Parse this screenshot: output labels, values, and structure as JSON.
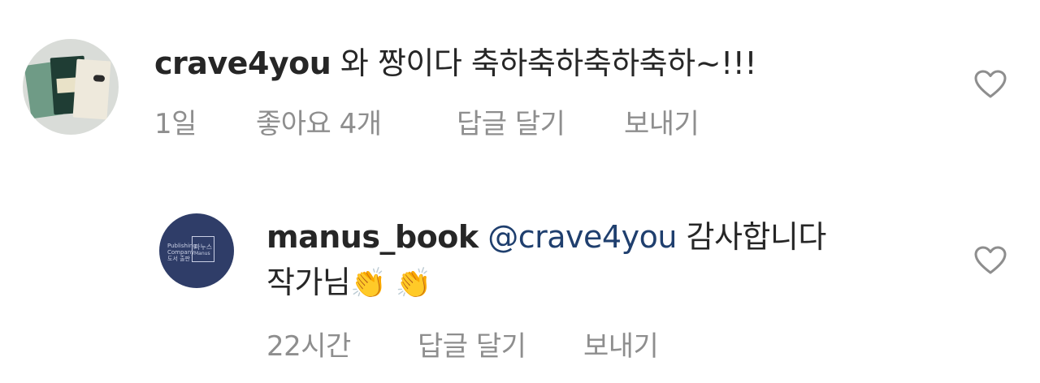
{
  "comments": [
    {
      "username": "crave4you",
      "text": "와 짱이다 축하축하축하축하~!!!",
      "time": "1일",
      "likes": "좋아요 4개",
      "reply": "답글 달기",
      "send": "보내기",
      "avatar_icon": "avatar-books-photo",
      "like_icon": "heart-outline-icon"
    },
    {
      "username": "manus_book",
      "mention": "@crave4you",
      "text_line1": "감사합니다",
      "text_line2": "작가님",
      "emoji": "👏 👏",
      "time": "22시간",
      "reply": "답글 달기",
      "send": "보내기",
      "avatar_logo": {
        "left_text_1": "Publishing",
        "left_text_2": "Company",
        "left_text_3": "도서 출판",
        "brand_ko": "마누스",
        "brand_en": "Manus"
      },
      "like_icon": "heart-outline-icon"
    }
  ],
  "colors": {
    "text": "#262626",
    "meta": "#8e8e8e",
    "mention": "#1f3f6e",
    "logo_bg": "#2f3d68"
  }
}
